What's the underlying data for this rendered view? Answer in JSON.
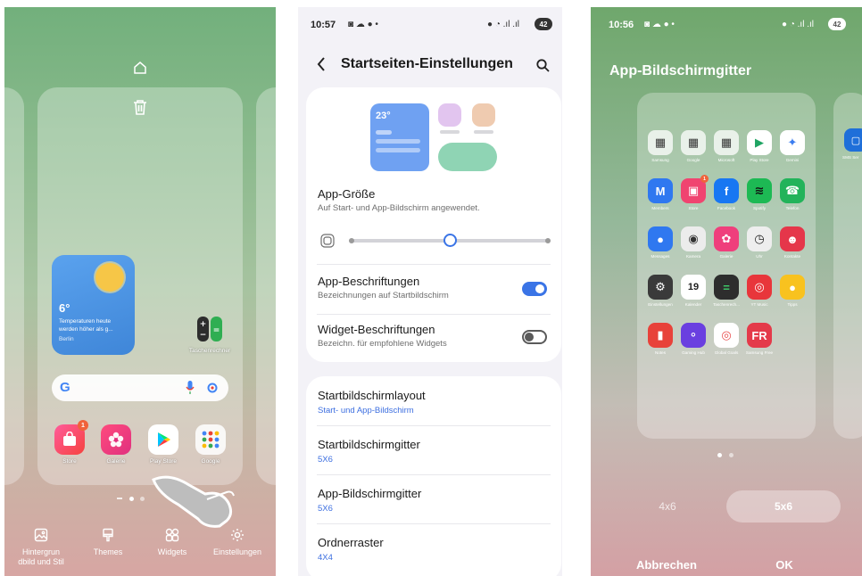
{
  "panel1": {
    "weather": {
      "temp": "6°",
      "text": "Temperaturen heute werden höher als g...",
      "city": "Berlin"
    },
    "calc_label": "Taschenrechner",
    "dock_apps": [
      {
        "label": "Store",
        "badge": "1"
      },
      {
        "label": "Galerie"
      },
      {
        "label": "Play Store"
      },
      {
        "label": "Google"
      }
    ],
    "bottom_bar": [
      {
        "label": "Hintergrun dbild und Stil",
        "icon": "image-icon"
      },
      {
        "label": "Themes",
        "icon": "brush-icon"
      },
      {
        "label": "Widgets",
        "icon": "widgets-icon"
      },
      {
        "label": "Einstellungen",
        "icon": "gear-icon"
      }
    ]
  },
  "panel2": {
    "status_time": "10:57",
    "battery": "42",
    "title": "Startseiten-Einstellungen",
    "preview_temp": "23°",
    "app_size": {
      "title": "App-Größe",
      "subtitle": "Auf Start- und App-Bildschirm angewendet.",
      "slider_value": 0.5
    },
    "toggles": [
      {
        "title": "App-Beschriftungen",
        "subtitle": "Bezeichnungen auf Startbildschirm",
        "on": true
      },
      {
        "title": "Widget-Beschriftungen",
        "subtitle": "Bezeichn. für empfohlene Widgets",
        "on": false
      }
    ],
    "settings": [
      {
        "title": "Startbildschirmlayout",
        "value": "Start- und App-Bildschirm"
      },
      {
        "title": "Startbildschirmgitter",
        "value": "5X6"
      },
      {
        "title": "App-Bildschirmgitter",
        "value": "5X6"
      },
      {
        "title": "Ordnerraster",
        "value": "4X4"
      }
    ]
  },
  "panel3": {
    "status_time": "10:56",
    "battery": "42",
    "title": "App-Bildschirmgitter",
    "side_label": "SMS Ser",
    "apps": [
      "Samsung",
      "Google",
      "Microsoft",
      "Play Store",
      "Gemini",
      "Members",
      "Store",
      "Facebook",
      "Spotify",
      "Telefon",
      "Messages",
      "Kamera",
      "Galerie",
      "Uhr",
      "Kontakte",
      "Einstellungen",
      "Kalender",
      "Taschenrech...",
      "YT Music",
      "Tipps",
      "Notes",
      "Gaming Hub",
      "Global Goals",
      "Samsung Free"
    ],
    "store_badge": "1",
    "calendar_day": "19",
    "options": [
      "4x6",
      "5x6"
    ],
    "selected_option": "5x6",
    "cancel_label": "Abbrechen",
    "ok_label": "OK"
  }
}
